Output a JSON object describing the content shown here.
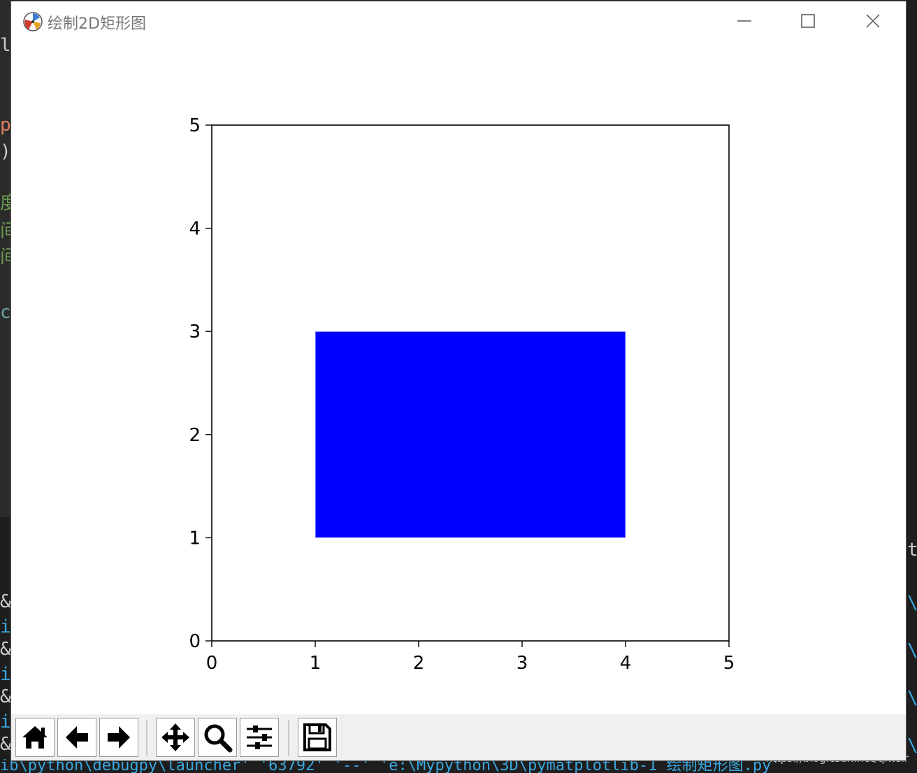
{
  "window": {
    "title": "绘制2D矩形图",
    "controls": {
      "minimize": "minimize",
      "maximize": "maximize",
      "close": "close"
    }
  },
  "chart_data": {
    "type": "rectangle",
    "xlim": [
      0,
      5
    ],
    "ylim": [
      0,
      5
    ],
    "xticks": [
      "0",
      "1",
      "2",
      "3",
      "4",
      "5"
    ],
    "yticks": [
      "0",
      "1",
      "2",
      "3",
      "4",
      "5"
    ],
    "rectangle": {
      "x": 1,
      "y": 1,
      "width": 3,
      "height": 2,
      "color": "#0000ff"
    },
    "grid": false
  },
  "toolbar": {
    "buttons": [
      {
        "name": "home",
        "icon": "home-icon"
      },
      {
        "name": "back",
        "icon": "arrow-left-icon"
      },
      {
        "name": "forward",
        "icon": "arrow-right-icon"
      },
      {
        "name": "pan",
        "icon": "move-icon"
      },
      {
        "name": "zoom",
        "icon": "magnifier-icon"
      },
      {
        "name": "configure-subplots",
        "icon": "sliders-icon"
      },
      {
        "name": "save",
        "icon": "floppy-disk-icon"
      }
    ]
  },
  "background": {
    "terminal_line": "ib\\python\\debugpy\\launcher' '63792' '--' 'e:\\Mypython\\3D\\pymatplotlib-1 绘制矩形图.py'",
    "watermark": "https://blog.csdn.net/qiwsir"
  }
}
